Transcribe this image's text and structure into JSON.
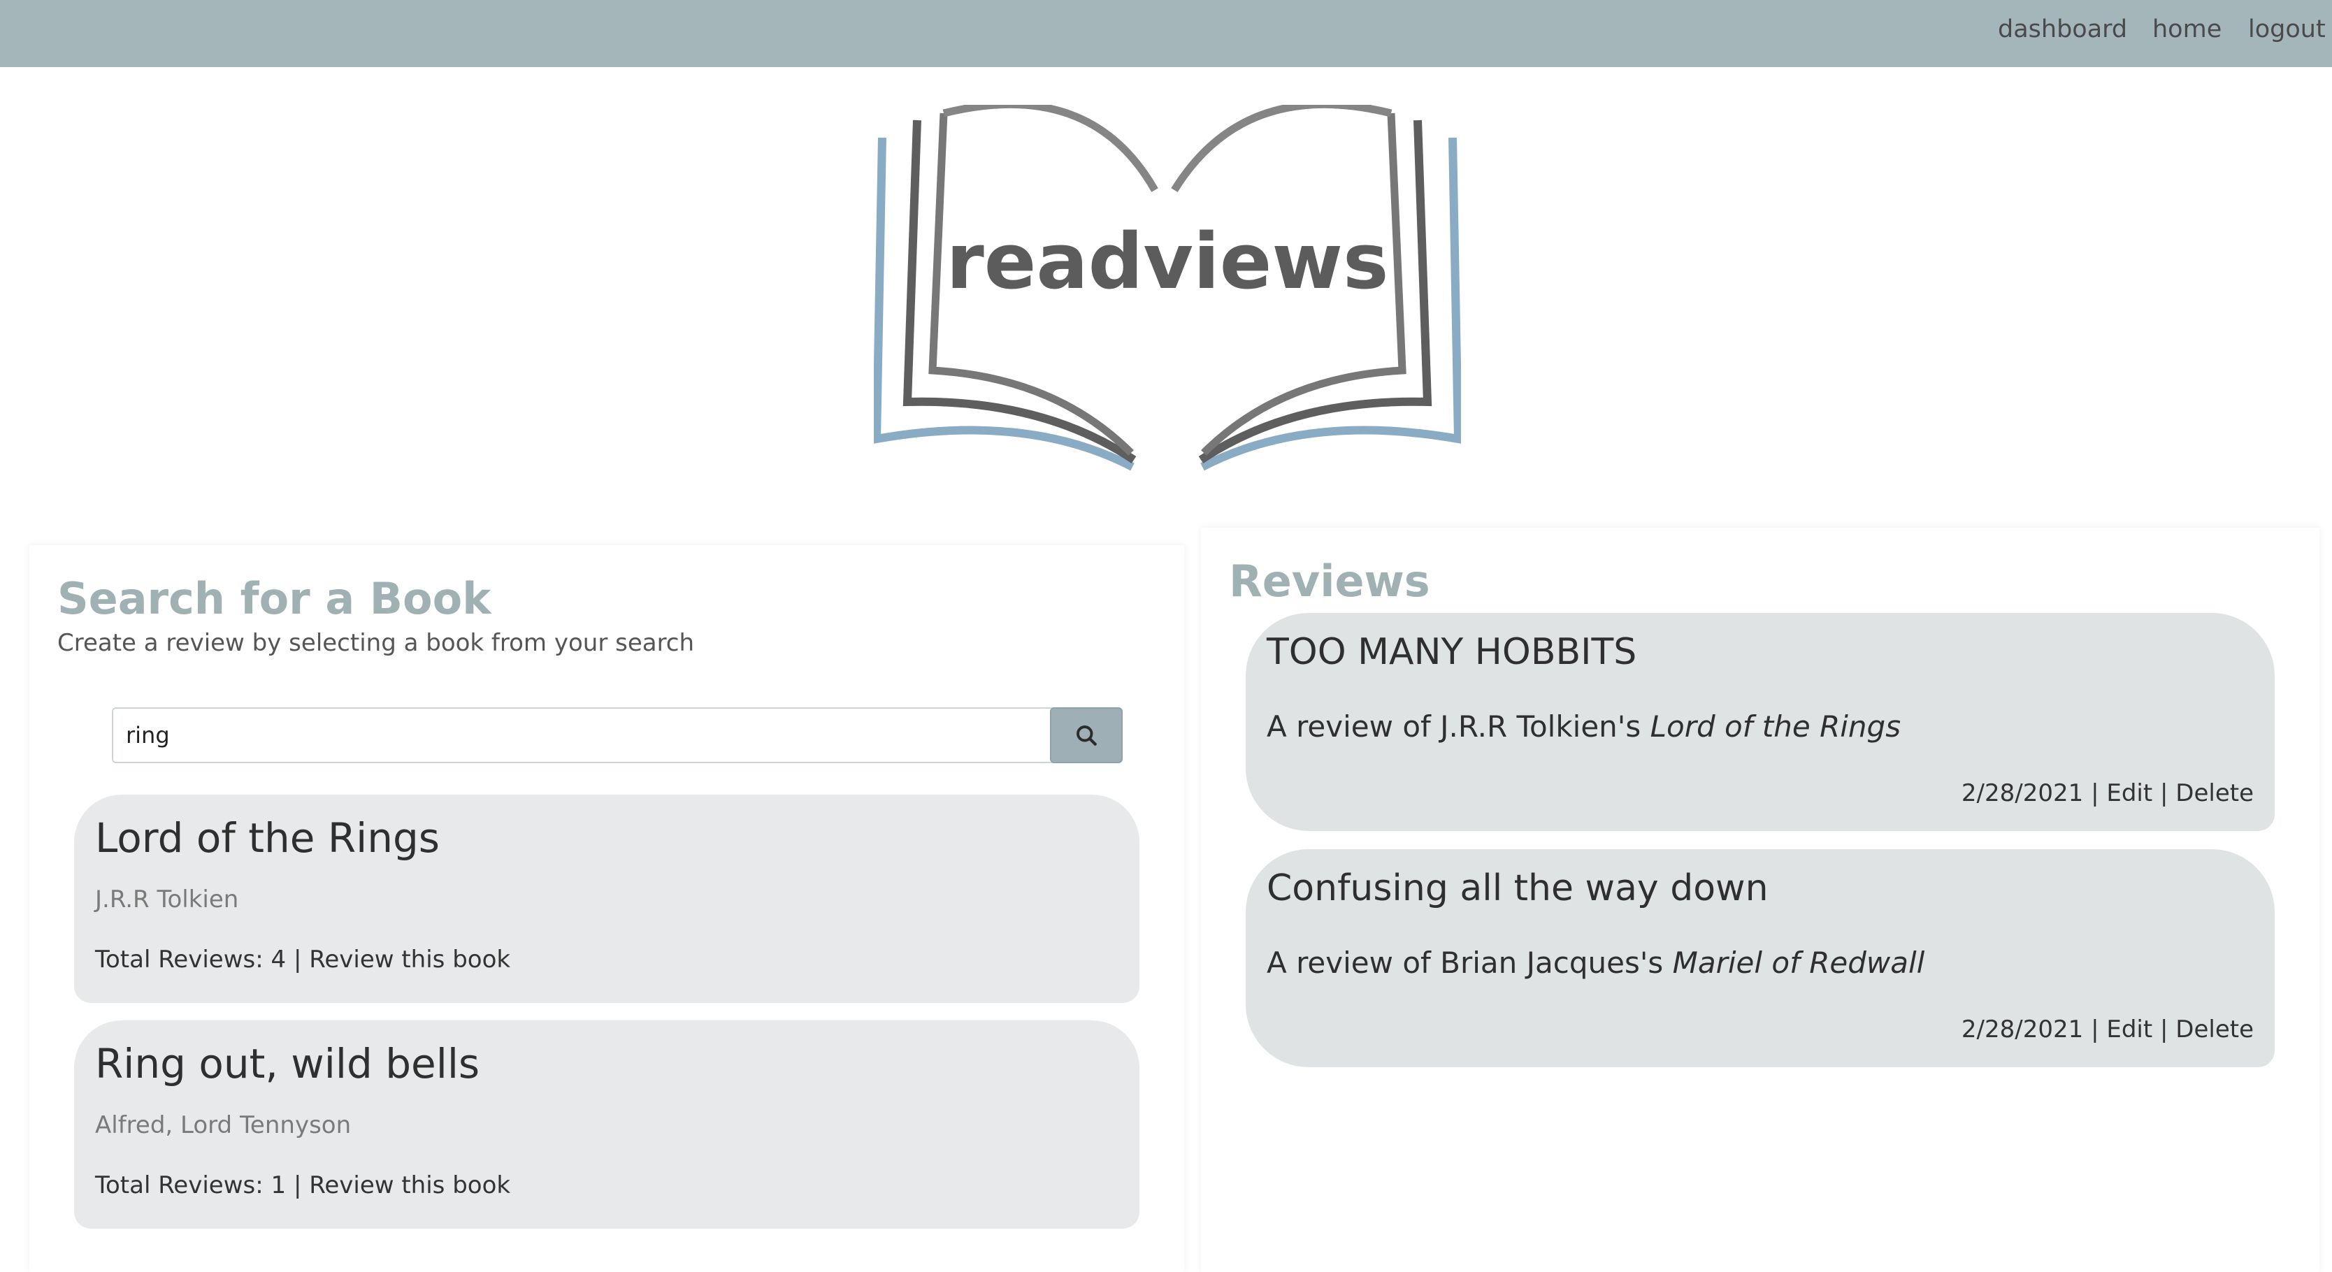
{
  "nav": {
    "dashboard": "dashboard",
    "home": "home",
    "logout": "logout"
  },
  "logo": {
    "text": "readviews",
    "icon": "open-book-icon"
  },
  "search": {
    "title": "Search for a Book",
    "subtitle": "Create a review by selecting a book from your search",
    "query": "ring",
    "button_icon": "search-icon",
    "results": [
      {
        "title": "Lord of the Rings",
        "author": "J.R.R Tolkien",
        "total_reviews": "Total Reviews: 4",
        "separator": "|",
        "action": "Review this book"
      },
      {
        "title": "Ring out, wild bells",
        "author": "Alfred, Lord Tennyson",
        "total_reviews": "Total Reviews: 1",
        "separator": "|",
        "action": "Review this book"
      }
    ]
  },
  "reviews": {
    "title": "Reviews",
    "items": [
      {
        "title": "TOO MANY HOBBITS",
        "prefix": "A review of J.R.R Tolkien's ",
        "book": "Lord of the Rings",
        "date": "2/28/2021",
        "edit": "Edit",
        "delete": "Delete",
        "separator": "|"
      },
      {
        "title": "Confusing all the way down",
        "prefix": "A review of Brian Jacques's ",
        "book": "Mariel of Redwall",
        "date": "2/28/2021",
        "edit": "Edit",
        "delete": "Delete",
        "separator": "|"
      }
    ]
  },
  "colors": {
    "navbar": "#a5b6ba",
    "accent": "#9fb1b3",
    "card": "#e7e9ea",
    "review_card": "#dfe3e4",
    "logo_blue": "#8aabc4"
  }
}
